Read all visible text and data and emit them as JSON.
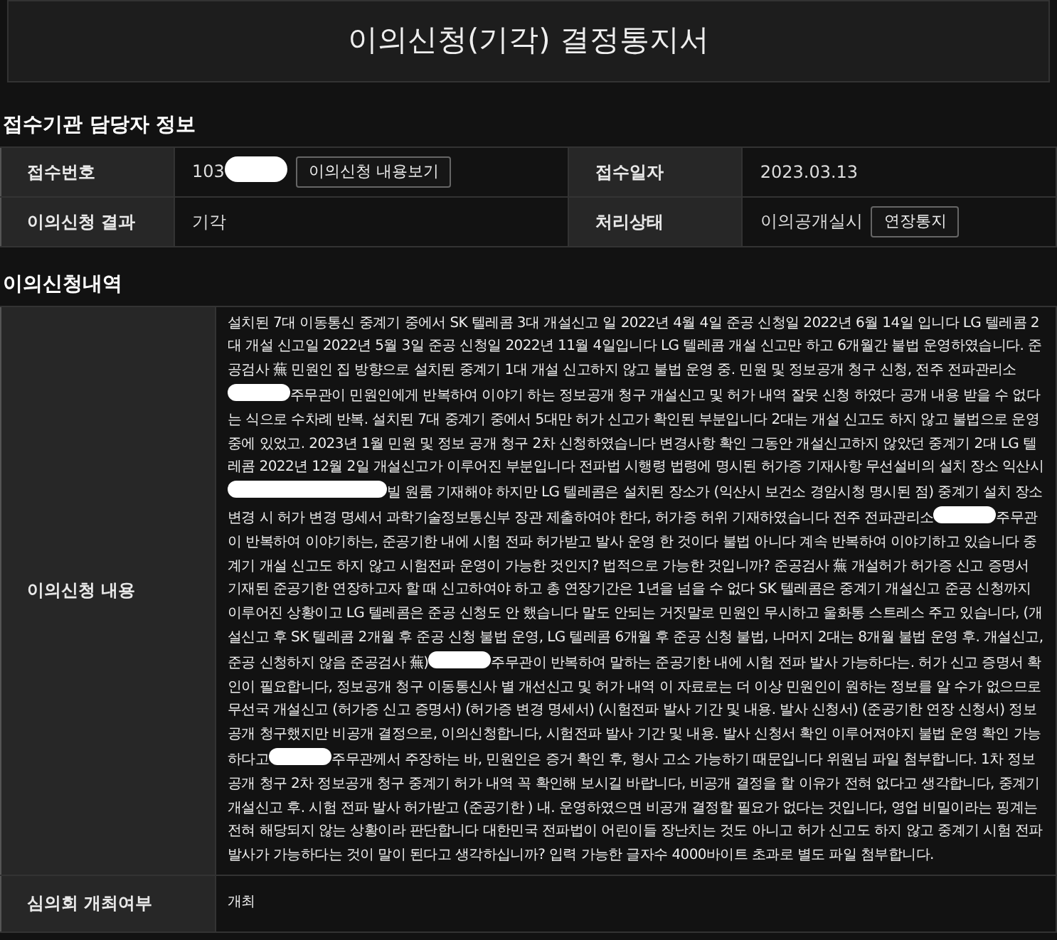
{
  "title": "이의신청(기각) 결정통지서",
  "sections": [
    {
      "heading": "접수기관 담당자 정보",
      "kind": "grid",
      "rows": [
        [
          {
            "label": "접수번호",
            "value": "103",
            "redacted": true,
            "button": "이의신청 내용보기"
          },
          {
            "label": "접수일자",
            "value": "2023.03.13"
          }
        ],
        [
          {
            "label": "이의신청 결과",
            "value": "기각"
          },
          {
            "label": "처리상태",
            "value": "이의공개실시",
            "button": "연장통지"
          }
        ]
      ]
    },
    {
      "heading": "이의신청내역",
      "kind": "list",
      "rows": [
        {
          "label": "이의신청 내용",
          "segments": [
            {
              "kind": "text",
              "text": "설치된 7대 이동통신 중계기 중에서 SK 텔레콤 3대 개설신고 일 2022년 4월 4일 준공 신청일 2022년 6월 14일 입니다 LG 텔레콤 2대 개설 신고일 2022년 5월 3일 준공 신청일 2022년 11월 4일입니다 LG 텔레콤 개설 신고만 하고 6개월간 불법 운영하였습니다. 준공검사 蕪 민원인 집 방향으로 설치된 중계기 1대 개설 신고하지 않고 불법 운영 중. 민원 및 정보공개 청구 신청, 전주 전파관리소"
            },
            {
              "kind": "redacted"
            },
            {
              "kind": "text",
              "text": "주무관이 민원인에게 반복하여 이야기 하는 정보공개 청구 개설신고 및 허가 내역 잘못 신청 하였다 공개 내용 받을 수 없다는 식으로 수차례 반복. 설치된 7대 중계기 중에서 5대만 허가 신고가 확인된 부분입니다 2대는 개설 신고도 하지 않고 불법으로 운영 중에 있었고. 2023년 1월 민원 및 정보 공개 청구 2차 신청하였습니다 변경사항 확인 그동안 개설신고하지 않았던 중계기 2대 LG 텔레콤 2022년 12월 2일 개설신고가 이루어진 부분입니다 전파법 시행령 법령에 명시된 허가증 기재사항 무선설비의 설치 장소 익산시"
            },
            {
              "kind": "redacted-long"
            },
            {
              "kind": "text",
              "text": "빌 원룸 기재해야 하지만 LG 텔레콤은 설치된 장소가 (익산시 보건소 경암시청 명시된 점) 중계기 설치 장소 변경 시 허가 변경 명세서 과학기술정보통신부 장관 제출하여야 한다, 허가증 허위 기재하였습니다 전주 전파관리소"
            },
            {
              "kind": "redacted"
            },
            {
              "kind": "text",
              "text": "주무관이 반복하여 이야기하는, 준공기한 내에 시험 전파 허가받고 발사 운영 한 것이다 불법 아니다 계속 반복하여 이야기하고 있습니다 중계기 개설 신고도 하지 않고 시험전파 운영이 가능한 것인지? 법적으로 가능한 것입니까? 준공검사 蕪 개설허가 허가증 신고 증명서 기재된 준공기한 연장하고자 할 때 신고하여야 하고 총 연장기간은 1년을 넘을 수 없다 SK 텔레콤은 중계기 개설신고 준공 신청까지 이루어진 상황이고 LG 텔레콤은 준공 신청도 안 했습니다 말도 안되는 거짓말로 민원인 무시하고 울화통 스트레스 주고 있습니다, (개설신고 후 SK 텔레콤 2개월 후 준공 신청 불법 운영, LG 텔레콤 6개월 후 준공 신청 불법, 나머지 2대는 8개월 불법 운영 후. 개설신고, 준공 신청하지 않음 준공검사 蕪)"
            },
            {
              "kind": "redacted"
            },
            {
              "kind": "text",
              "text": "주무관이 반복하여 말하는 준공기한 내에 시험 전파 발사 가능하다는. 허가 신고 증명서 확인이 필요합니다, 정보공개 청구 이동통신사 별 개선신고 및 허가 내역 이 자료로는 더 이상 민원인이 원하는 정보를 알 수가 없으므로 무선국 개설신고 (허가증 신고 증명서) (허가증 변경 명세서) (시험전파 발사 기간 및 내용. 발사 신청서) (준공기한 연장 신청서) 정보 공개 청구했지만 비공개 결정으로, 이의신청합니다, 시험전파 발사 기간 및 내용. 발사 신청서 확인 이루어져야지 불법 운영 확인 가능하다고"
            },
            {
              "kind": "redacted"
            },
            {
              "kind": "text",
              "text": "주무관께서 주장하는 바, 민원인은 증거 확인 후, 형사 고소 가능하기 때문입니다 위원님 파일 첨부합니다. 1차 정보공개 청구 2차 정보공개 청구 중계기 허가 내역 꼭 확인해 보시길 바랍니다, 비공개 결정을 할 이유가 전혀 없다고 생각합니다, 중계기 개설신고 후. 시험 전파 발사 허가받고 (준공기한 ) 내. 운영하였으면 비공개 결정할 필요가 없다는 것입니다, 영업 비밀이라는 핑계는 전혀 해당되지 않는 상황이라 판단합니다 대한민국 전파법이 어린이들 장난치는 것도 아니고 허가 신고도 하지 않고 중계기 시험 전파 발사가 가능하다는 것이 말이 된다고 생각하십니까? 입력 가능한 글자수 4000바이트 초과로 별도 파일 첨부합니다."
            }
          ]
        },
        {
          "label": "심의회 개최여부",
          "segments": [
            {
              "kind": "text",
              "text": "개최"
            }
          ]
        }
      ]
    }
  ]
}
